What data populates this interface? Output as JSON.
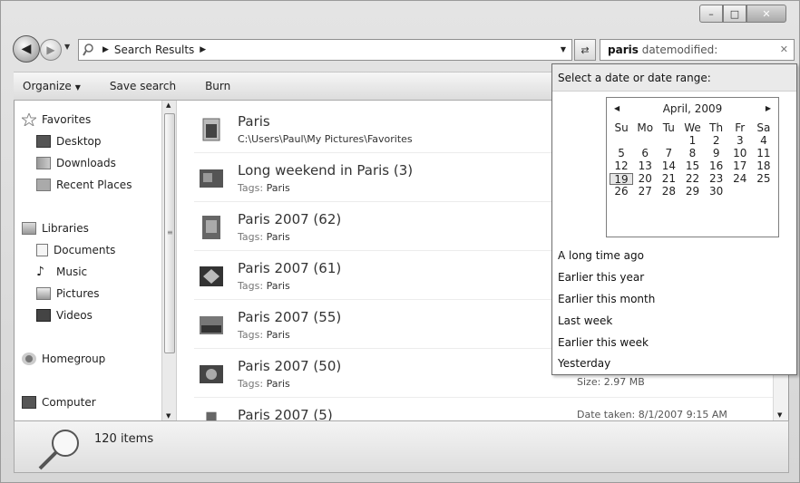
{
  "address": {
    "crumbs": [
      "Search Results"
    ]
  },
  "search": {
    "term": "paris",
    "filter": "datemodified:"
  },
  "toolbar": {
    "organize": "Organize",
    "save_search": "Save search",
    "burn": "Burn"
  },
  "nav": {
    "favorites": "Favorites",
    "desktop": "Desktop",
    "downloads": "Downloads",
    "recent": "Recent Places",
    "libraries": "Libraries",
    "documents": "Documents",
    "music": "Music",
    "pictures": "Pictures",
    "videos": "Videos",
    "homegroup": "Homegroup",
    "computer": "Computer"
  },
  "results": [
    {
      "title": "Paris",
      "sub_label": "",
      "sub_value": "C:\\Users\\Paul\\My Pictures\\Favorites"
    },
    {
      "title": "Long weekend in Paris  (3)",
      "sub_label": "Tags:",
      "sub_value": "Paris"
    },
    {
      "title": "Paris 2007 (62)",
      "sub_label": "Tags:",
      "sub_value": "Paris"
    },
    {
      "title": "Paris 2007 (61)",
      "sub_label": "Tags:",
      "sub_value": "Paris"
    },
    {
      "title": "Paris 2007 (55)",
      "sub_label": "Tags:",
      "sub_value": "Paris"
    },
    {
      "title": "Paris 2007 (50)",
      "sub_label": "Tags:",
      "sub_value": "Paris"
    },
    {
      "title": "Paris 2007 (5)",
      "sub_label": "",
      "sub_value": ""
    }
  ],
  "result_meta": {
    "size_label": "Size:",
    "size_value": "2.97 MB",
    "date_taken_label": "Date taken:",
    "date_taken_value": "8/1/2007 9:15 AM"
  },
  "status": {
    "count": "120 items"
  },
  "popup": {
    "header": "Select a date or date range:",
    "month": "April, 2009",
    "weekdays": [
      "Su",
      "Mo",
      "Tu",
      "We",
      "Th",
      "Fr",
      "Sa"
    ],
    "days": [
      "",
      "",
      "",
      "1",
      "2",
      "3",
      "4",
      "5",
      "6",
      "7",
      "8",
      "9",
      "10",
      "11",
      "12",
      "13",
      "14",
      "15",
      "16",
      "17",
      "18",
      "19",
      "20",
      "21",
      "22",
      "23",
      "24",
      "25",
      "26",
      "27",
      "28",
      "29",
      "30",
      "",
      ""
    ],
    "today": "19",
    "presets": [
      "A long time ago",
      "Earlier this year",
      "Earlier this month",
      "Last week",
      "Earlier this week",
      "Yesterday"
    ]
  }
}
